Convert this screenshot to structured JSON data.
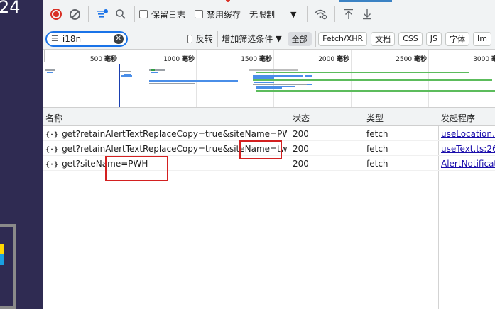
{
  "page": {
    "partial_number": "24"
  },
  "toolbar": {
    "preserve_log_label": "保留日志",
    "disable_cache_label": "禁用缓存",
    "throttle_label": "无限制"
  },
  "filter": {
    "value": "i18n",
    "invert_label": "反转",
    "more_filters_label": "增加筛选条件",
    "types": [
      "全部",
      "Fetch/XHR",
      "文档",
      "CSS",
      "JS",
      "字体",
      "Im"
    ]
  },
  "timeline": {
    "unit": "毫秒",
    "ticks": [
      "500",
      "1000",
      "1500",
      "2000",
      "2500",
      "3000"
    ]
  },
  "table": {
    "headers": {
      "name": "名称",
      "status": "状态",
      "type": "类型",
      "initiator": "发起程序"
    },
    "rows": [
      {
        "name": "get?retainAlertTextReplaceCopy=true&siteName=PWH",
        "status": "200",
        "type": "fetch",
        "initiator": "useLocation.ts"
      },
      {
        "name": "get?retainAlertTextReplaceCopy=true&siteName=twsc&m...",
        "status": "200",
        "type": "fetch",
        "initiator": "useText.ts:26"
      },
      {
        "name": "get?siteName=PWH",
        "status": "200",
        "type": "fetch",
        "initiator": "AlertNotification"
      }
    ]
  },
  "colors": {
    "accent": "#1a73e8",
    "record": "#d93025",
    "highlight_box": "#d32020",
    "link": "#1a0dab"
  }
}
